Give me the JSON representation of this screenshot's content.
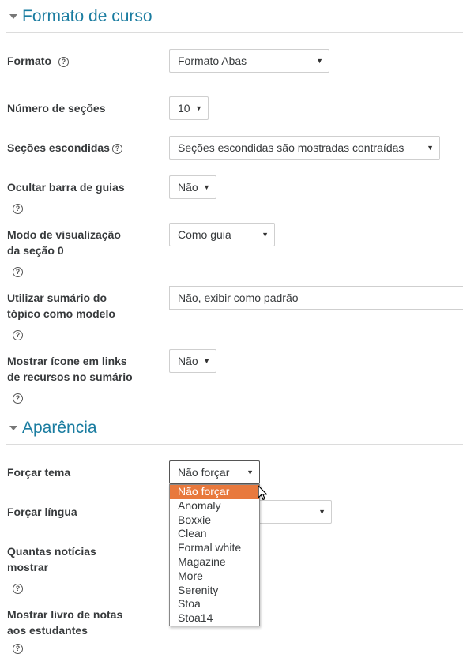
{
  "sections": {
    "course_format": "Formato de curso",
    "appearance": "Aparência"
  },
  "fields": {
    "format": {
      "label": "Formato",
      "value": "Formato Abas"
    },
    "num_sections": {
      "label": "Número de seções",
      "value": "10"
    },
    "hidden_sections": {
      "label": "Seções escondidas",
      "value": "Seções escondidas são mostradas contraídas"
    },
    "hide_tabbar": {
      "label": "Ocultar barra de guias",
      "value": "Não"
    },
    "section0_mode": {
      "label_line1": "Modo de visualização",
      "label_line2": "da seção 0",
      "value": "Como guia"
    },
    "topic_summary": {
      "label_line1": "Utilizar sumário do",
      "label_line2": "tópico como modelo",
      "value": "Não, exibir como padrão"
    },
    "show_icon": {
      "label_line1": "Mostrar ícone em links",
      "label_line2": "de recursos no sumário",
      "value": "Não"
    },
    "force_theme": {
      "label": "Forçar tema",
      "value": "Não forçar"
    },
    "force_language": {
      "label": "Forçar língua"
    },
    "news_items": {
      "label_line1": "Quantas notícias",
      "label_line2": "mostrar"
    },
    "show_grades": {
      "label_line1": "Mostrar livro de notas",
      "label_line2": "aos estudantes"
    }
  },
  "theme_dropdown": {
    "options": [
      "Não forçar",
      "Anomaly",
      "Boxxie",
      "Clean",
      "Formal white",
      "Magazine",
      "More",
      "Serenity",
      "Stoa",
      "Stoa14"
    ],
    "highlighted_index": 0,
    "highlight_color": "#e8793d"
  },
  "icons": {
    "help": "?",
    "arrow": "▼"
  }
}
